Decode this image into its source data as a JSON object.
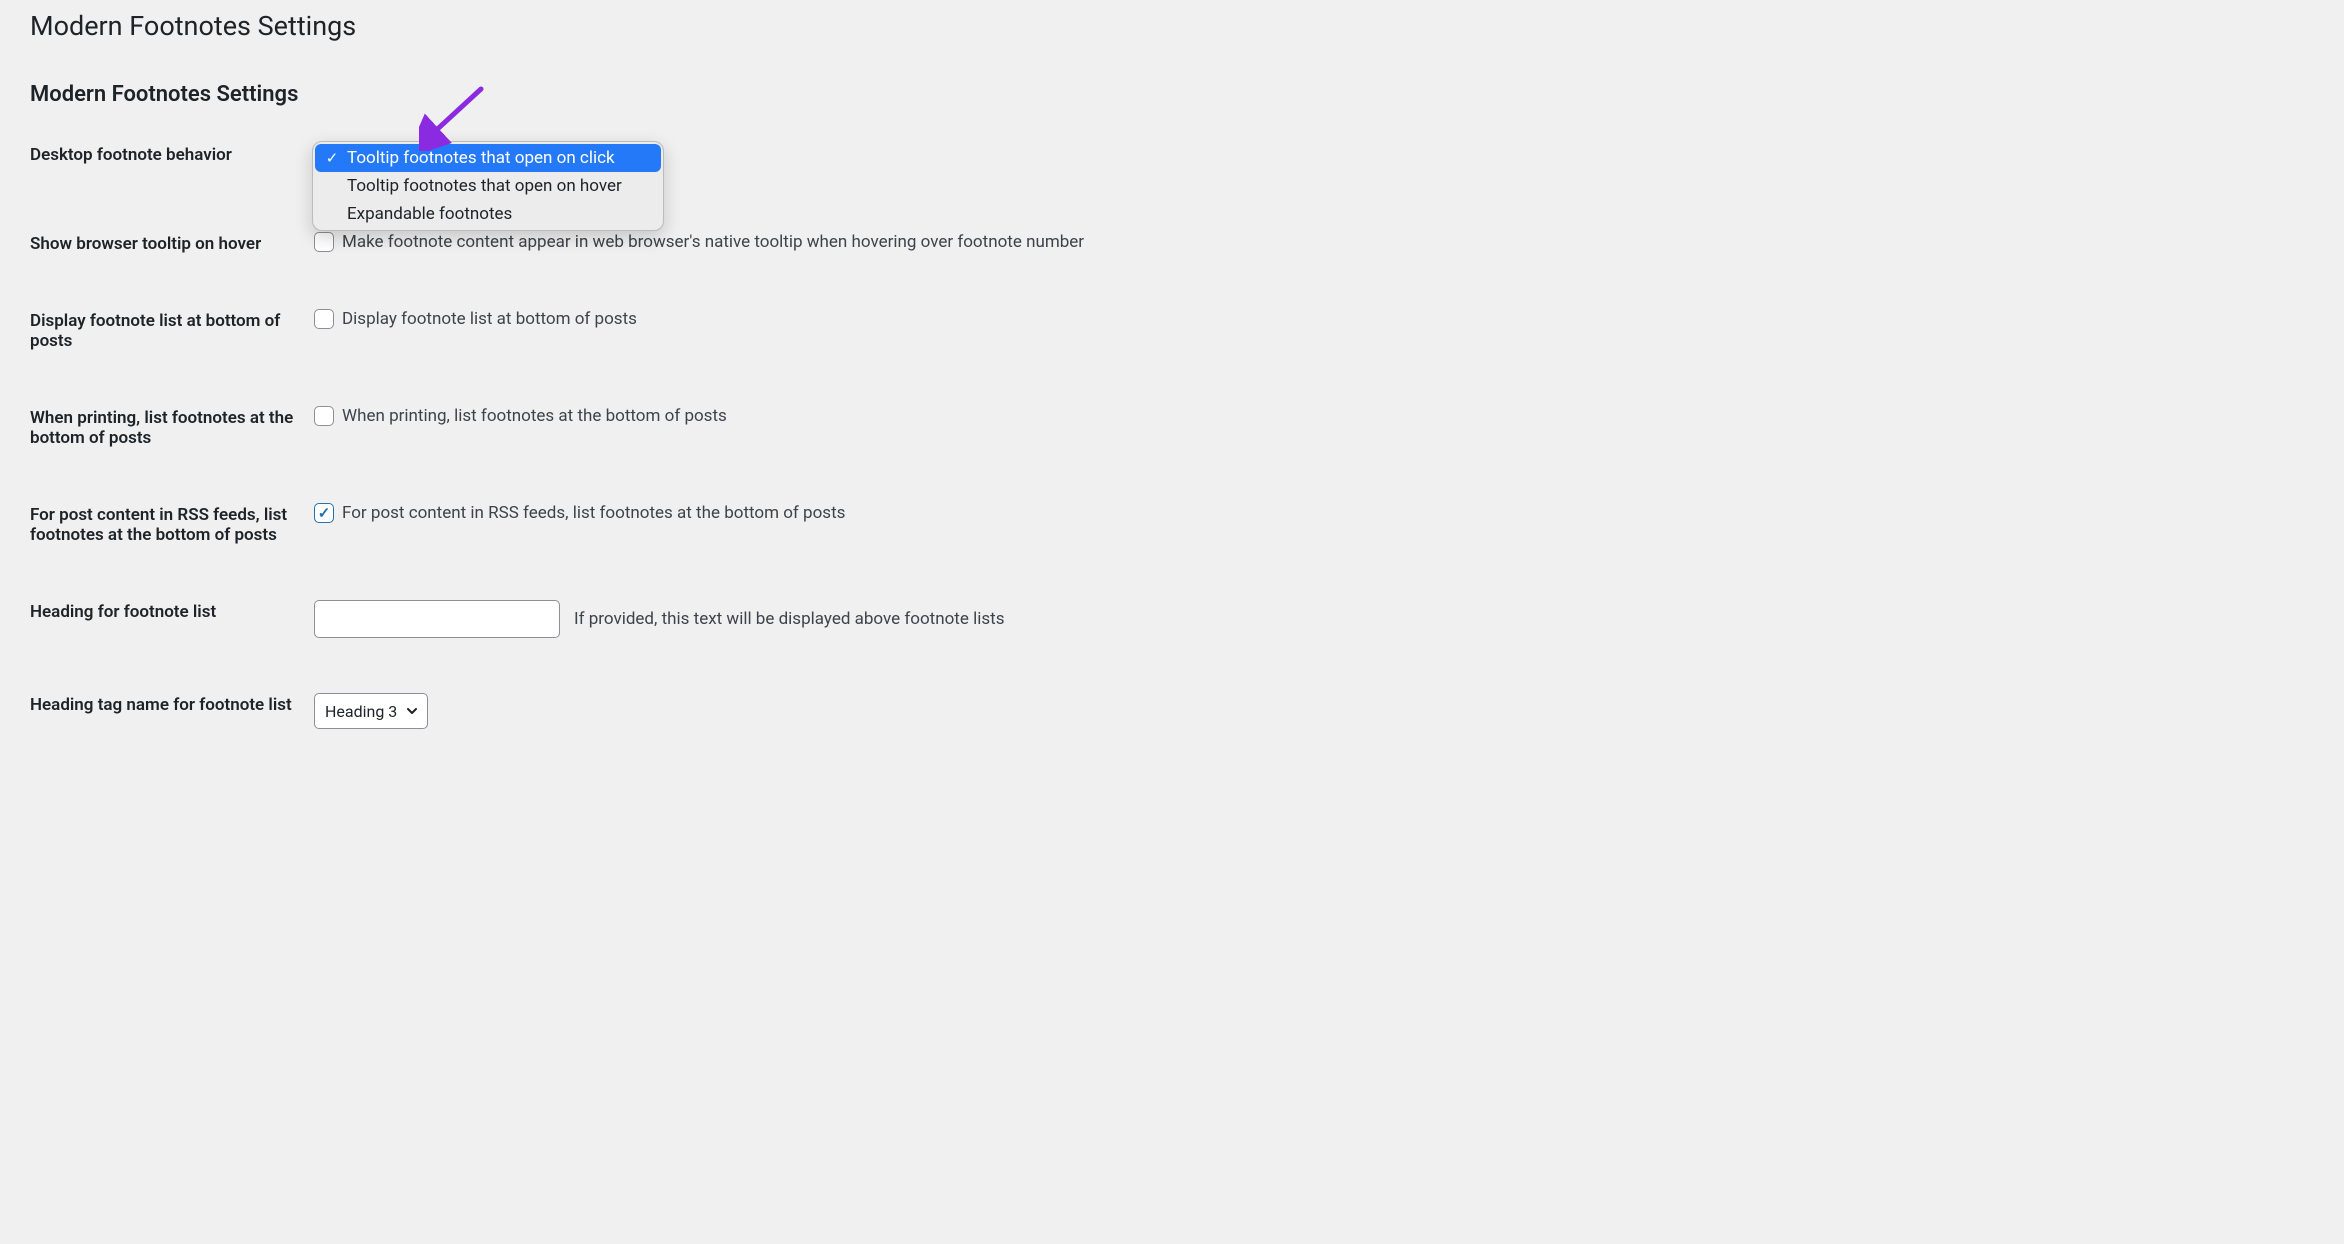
{
  "page_title": "Modern Footnotes Settings",
  "section_title": "Modern Footnotes Settings",
  "rows": {
    "behavior": {
      "label": "Desktop footnote behavior",
      "dropdown": {
        "options": [
          "Tooltip footnotes that open on click",
          "Tooltip footnotes that open on hover",
          "Expandable footnotes"
        ],
        "selected_index": 0
      }
    },
    "browser_tooltip": {
      "label": "Show browser tooltip on hover",
      "checkbox_label": "Make footnote content appear in web browser's native tooltip when hovering over footnote number",
      "checked": false
    },
    "display_list": {
      "label": "Display footnote list at bottom of posts",
      "checkbox_label": "Display footnote list at bottom of posts",
      "checked": false
    },
    "printing": {
      "label": "When printing, list footnotes at the bottom of posts",
      "checkbox_label": "When printing, list footnotes at the bottom of posts",
      "checked": false
    },
    "rss": {
      "label": "For post content in RSS feeds, list footnotes at the bottom of posts",
      "checkbox_label": "For post content in RSS feeds, list footnotes at the bottom of posts",
      "checked": true
    },
    "heading_text": {
      "label": "Heading for footnote list",
      "value": "",
      "hint": "If provided, this text will be displayed above footnote lists"
    },
    "heading_tag": {
      "label": "Heading tag name for footnote list",
      "value": "Heading 3"
    }
  },
  "annotation": {
    "arrow_color": "#8a2be2"
  }
}
